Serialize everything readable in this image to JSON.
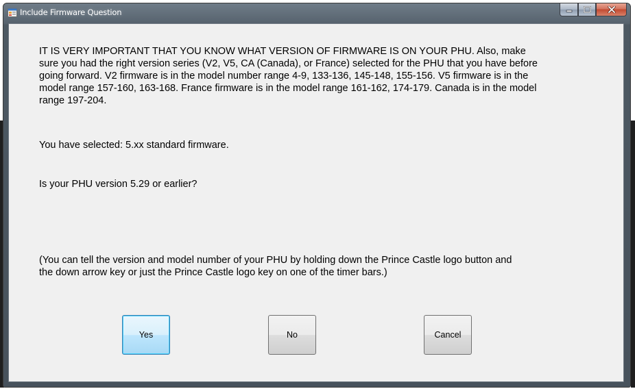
{
  "window": {
    "title": "Include Firmware Question",
    "icon": "form-app-icon",
    "controls": {
      "minimize_icon": "minimize-icon",
      "maximize_icon": "maximize-icon",
      "close_icon": "close-icon"
    }
  },
  "message": {
    "main_line1": "IT IS VERY IMPORTANT THAT YOU KNOW WHAT VERSION OF FIRMWARE IS ON YOUR PHU.  Also, make",
    "main_line2": "sure you had the right version series (V2, V5, CA (Canada), or France) selected for the PHU that you have before",
    "main_line3": "going forward.  V2 firmware is in the model number range 4-9, 133-136, 145-148, 155-156.  V5 firmware is in the",
    "main_line4": "model range 157-160, 163-168.  France firmware is in the model range 161-162, 174-179.  Canada is in the model",
    "main_line5": "range 197-204.",
    "selected": "You have selected: 5.xx standard firmware.",
    "question": "Is your PHU version 5.29 or earlier?",
    "hint_line1": "(You can tell the version and model number of your PHU by holding down the Prince Castle logo button and",
    "hint_line2": "the down arrow key or just the Prince Castle logo key on one of the timer bars.)"
  },
  "buttons": {
    "yes": "Yes",
    "no": "No",
    "cancel": "Cancel"
  },
  "colors": {
    "title_bar": "#56626d",
    "client_bg": "#f0f0f0",
    "close_button": "#c24a31",
    "default_button_border": "#3c7fb1"
  }
}
